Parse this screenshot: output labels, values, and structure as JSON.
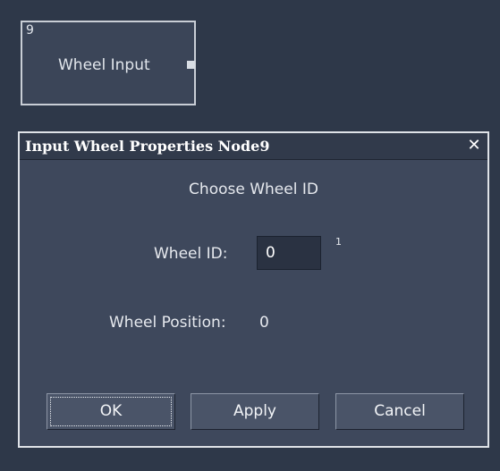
{
  "node": {
    "id": "9",
    "label": "Wheel Input"
  },
  "dialog": {
    "title": "Input Wheel Properties Node9",
    "close_glyph": "✕",
    "caption": "Choose Wheel ID",
    "wheel_id_label": "Wheel ID:",
    "wheel_id_value": "0",
    "wheel_id_hint": "1",
    "wheel_position_label": "Wheel Position:",
    "wheel_position_value": "0",
    "buttons": {
      "ok": "OK",
      "apply": "Apply",
      "cancel": "Cancel"
    }
  },
  "icons": {
    "close": "close-icon",
    "port": "output-port-icon"
  },
  "colors": {
    "background": "#2e3849",
    "dialog": "#3e485c",
    "titlebar": "#313a4b",
    "input": "#2a3242",
    "button": "#4a5468"
  }
}
